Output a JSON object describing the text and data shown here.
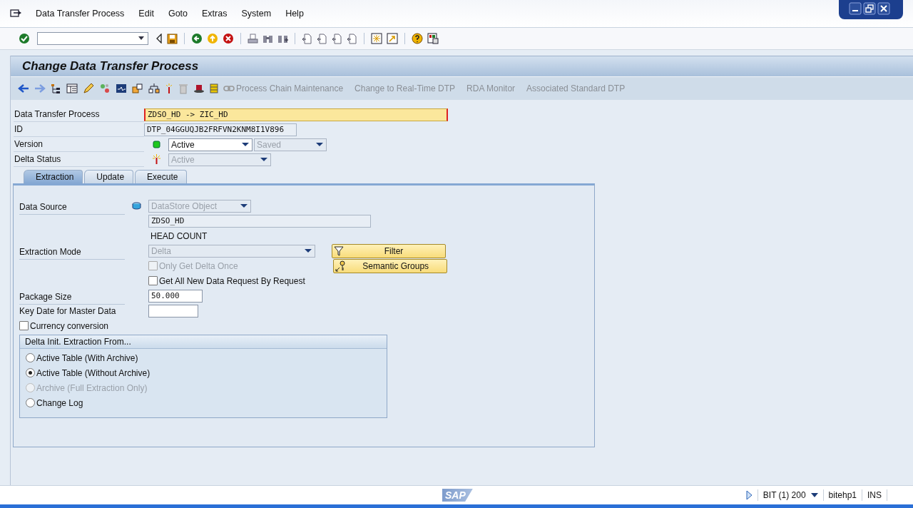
{
  "menu": [
    "Data Transfer Process",
    "Edit",
    "Goto",
    "Extras",
    "System",
    "Help"
  ],
  "title": "Change Data Transfer Process",
  "app_toolbar": [
    {
      "label": "Process Chain Maintenance",
      "disabled": true
    },
    {
      "label": "Change to Real-Time DTP",
      "disabled": true
    },
    {
      "label": "RDA Monitor",
      "disabled": true
    },
    {
      "label": "Associated Standard DTP",
      "disabled": true
    }
  ],
  "header": {
    "dtp": {
      "label": "Data Transfer Process",
      "value": "ZDSO_HD -> ZIC_HD"
    },
    "id": {
      "label": "ID",
      "value": "DTP_04GGUQJB2FRFVN2KNM8I1V896"
    },
    "version": {
      "label": "Version",
      "value": "Active",
      "disabled": false,
      "status": "Saved",
      "status_disabled": true
    },
    "delta_status": {
      "label": "Delta Status",
      "value": "Active",
      "disabled": true
    }
  },
  "tabs": [
    {
      "label": "Extraction",
      "selected": true
    },
    {
      "label": "Update",
      "selected": false
    },
    {
      "label": "Execute",
      "selected": false
    }
  ],
  "extraction": {
    "data_source": {
      "label": "Data Source",
      "type": "DataStore Object",
      "name": "ZDSO_HD",
      "description": "HEAD COUNT"
    },
    "extraction_mode": {
      "label": "Extraction Mode",
      "value": "Delta"
    },
    "checkboxes": [
      {
        "label": "Only Get Delta Once",
        "checked": false,
        "disabled": true
      },
      {
        "label": "Get All New Data Request By Request",
        "checked": false,
        "disabled": false
      }
    ],
    "buttons": [
      {
        "label": "Filter",
        "kind": "filter"
      },
      {
        "label": "Semantic Groups",
        "kind": "key"
      }
    ],
    "package_size": {
      "label": "Package Size",
      "value": "50.000"
    },
    "key_date": {
      "label": "Key Date for Master Data"
    },
    "currency_conversion": {
      "label": "Currency conversion",
      "checked": false
    },
    "delta_init": {
      "title": "Delta Init. Extraction From...",
      "options": [
        {
          "label": "Active Table (With Archive)",
          "selected": false,
          "disabled": false
        },
        {
          "label": "Active Table (Without Archive)",
          "selected": true,
          "disabled": false
        },
        {
          "label": "Archive (Full Extraction Only)",
          "selected": false,
          "disabled": true
        },
        {
          "label": "Change Log",
          "selected": false,
          "disabled": false
        }
      ]
    }
  },
  "status_bar": {
    "logo": "SAP",
    "system": "BIT (1) 200",
    "server": "bitehp1",
    "mode": "INS"
  }
}
